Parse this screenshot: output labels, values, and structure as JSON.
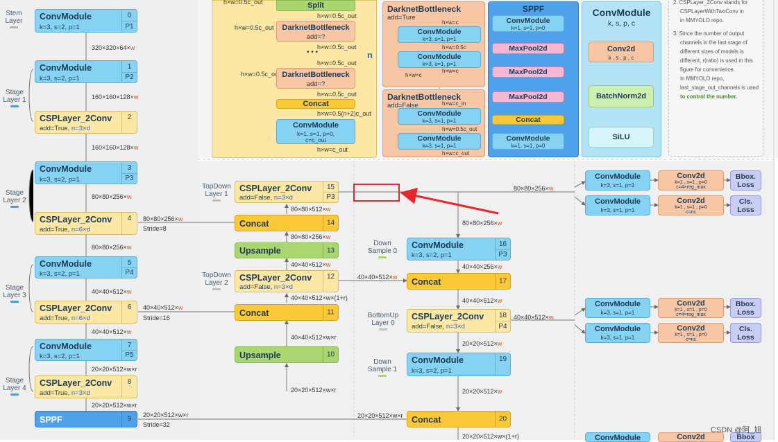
{
  "backbone": {
    "stem": "Stem\nLayer",
    "stage1": "Stage\nLayer 1",
    "stage2": "Stage\nLayer 2",
    "stage3": "Stage\nLayer 3",
    "stage4": "Stage\nLayer 4",
    "b0": {
      "title": "ConvModule",
      "sub": "k=3, s=2, p=1",
      "n": "0",
      "p": "P1"
    },
    "b1": {
      "title": "ConvModule",
      "sub": "k=3, s=2, p=1",
      "n": "1",
      "p": "P2"
    },
    "b2": {
      "title": "CSPLayer_2Conv",
      "sub_a": "add=True, ",
      "sub_b": "n=3×d",
      "n": "2"
    },
    "b3": {
      "title": "ConvModule",
      "sub": "k=3, s=2, p=1",
      "n": "3",
      "p": "P3"
    },
    "b4": {
      "title": "CSPLayer_2Conv",
      "sub_a": "add=True, ",
      "sub_b": "n=6×d",
      "n": "4"
    },
    "b5": {
      "title": "ConvModule",
      "sub": "k=3, s=2, p=1",
      "n": "5",
      "p": "P4"
    },
    "b6": {
      "title": "CSPLayer_2Conv",
      "sub_a": "add=True, ",
      "sub_b": "n=6×d",
      "n": "6"
    },
    "b7": {
      "title": "ConvModule",
      "sub": "k=3, s=2, p=1",
      "n": "7",
      "p": "P5"
    },
    "b8": {
      "title": "CSPLayer_2Conv",
      "sub_a": "add=True, ",
      "sub_b": "n=3×d",
      "n": "8"
    },
    "b9": {
      "title": "SPPF",
      "n": "9"
    },
    "l0": "320×320×64×",
    "l1": "160×160×128×",
    "l2": "160×160×128×",
    "l3": "80×80×256×",
    "l4": "80×80×256×",
    "l5": "40×40×512×",
    "l6": "40×40×512×",
    "l7": "20×20×512×w×r",
    "l8": "20×20×512×w×r",
    "out4": "80×80×256×",
    "stride8": "Stride=8",
    "out6": "40×40×512×",
    "stride16": "Stride=16",
    "out9": "20×20×512×w×r",
    "stride32": "Stride=32",
    "w": "w"
  },
  "neck": {
    "td1": "TopDown\nLayer 1",
    "td2": "TopDown\nLayer 2",
    "ds0": "Down\nSample 0",
    "ds1": "Down\nSample 1",
    "bu0": "BottomUp\nLayer 0",
    "n15": {
      "title": "CSPLayer_2Conv",
      "sub_a": "add=False, ",
      "sub_b": "n=3×d",
      "n": "15",
      "p": "P3"
    },
    "n14": {
      "title": "Concat",
      "n": "14"
    },
    "n13": {
      "title": "Upsample",
      "n": "13"
    },
    "n12": {
      "title": "CSPLayer_2Conv",
      "sub_a": "add=False, ",
      "sub_b": "n=3×d",
      "n": "12"
    },
    "n11": {
      "title": "Concat",
      "n": "11"
    },
    "n10": {
      "title": "Upsample",
      "n": "10"
    },
    "n16": {
      "title": "ConvModule",
      "sub": "k=3, s=2, p=1",
      "n": "16",
      "p": "P3"
    },
    "n17": {
      "title": "Concat",
      "n": "17"
    },
    "n18": {
      "title": "CSPLayer_2Conv",
      "sub_a": "add=False, ",
      "sub_b": "n=3×d",
      "n": "18",
      "p": "P4"
    },
    "n19": {
      "title": "ConvModule",
      "sub": "k=3, s=2, p=1",
      "n": "19"
    },
    "n20": {
      "title": "Concat",
      "n": "20"
    },
    "lab_a": "80×80×512×",
    "lab_b": "80×80×256×",
    "lab_c": "40×40×512×",
    "lab_d": "40×40×512×w×(1+r)",
    "lab_e": "40×40×512×w×r",
    "lab_f": "20×20×512×w×r",
    "lab_g": "80×80×256×",
    "lab_h": "40×40×256×",
    "lab_i": "40×40×512×",
    "lab_j": "20×20×512×",
    "lab_k": "20×20×512×w×(1+r)",
    "lab_l": "80×80×256×",
    "lab_m": "40×40×512×",
    "lab_n": "40×40×512×",
    "lab_o": "20×20×512×w×r"
  },
  "head": {
    "conv": "ConvModule",
    "conv_sub": "k=3, s=1, p=1",
    "conv2d": "Conv2d",
    "reg_sub1": "k=1 , s=1 , p=0",
    "reg_sub2": "c=4×reg_max",
    "cls_sub1": "k=1 , s=1 , p=0",
    "cls_sub2": "c=nc",
    "bbox": "Bbox.\nLoss",
    "cls": "Cls.\nLoss",
    "bbox_cut": "Bbox"
  },
  "top": {
    "split": "Split",
    "hw_05c_out": "h×w=0.5c_out",
    "hw_05c_out_b": "h×w=0.5c_out",
    "db": "DarknetBottleneck",
    "add_q": "add=?",
    "dots": "• • •",
    "n": "n",
    "concat": "Concat",
    "hw_05n2": "h×w=0.5(n+2)c_out",
    "conv": "ConvModule",
    "conv_sub1": "k=1, s=1, p=0,",
    "conv_sub2": "c=c_out",
    "hw_cout": "h×w=c_out",
    "dbt_title": "DarknetBottleneck",
    "dbt_add": "add=Ture",
    "dbf_title": "DarknetBottleneck",
    "dbf_add": "add=False",
    "cm": "ConvModule",
    "cm_sub": "k=3, s=1, p=1",
    "hw_c": "h×w=c",
    "hw_05c": "h×w=0.5c",
    "hw_c_in": "h×w=c_in",
    "hw_05c_out2": "h×w=0.5c_out",
    "hw_c_out2": "h×w=c_out",
    "sppf": "SPPF",
    "sppf_conv": "ConvModule",
    "sppf_sub": "k=1, s=1, p=0",
    "maxpool": "MaxPool2d",
    "sppf_concat": "Concat",
    "cmod": "ConvModule",
    "cmod_params": "k, s,  p, c",
    "c2d": "Conv2d",
    "c2d_params": "k , s , p , c",
    "bn": "BatchNorm2d",
    "silu": "SiLU"
  },
  "notes": {
    "n2a": "2.  CSPLayer_2Conv  stands for",
    "n2b": "CSPLayerWithTwoConv  in",
    "n2c": "in MMYOLO repo.",
    "n3a": "3. Since the number of output",
    "n3b": "channels in the last stage of",
    "n3c": "different sizes of models is",
    "n3d": "different, r(ratio) is used in this",
    "n3e": "figure for convenience.",
    "n3f": "In MMYOLO repo,",
    "n3g": "last_stage_out_channels is used",
    "n3h": "to control the number."
  },
  "watermark": "CSDN @阿_旭"
}
